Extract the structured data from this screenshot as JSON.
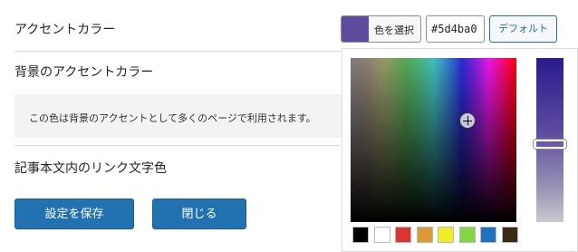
{
  "settings": {
    "accent_color_label": "アクセントカラー",
    "bg_accent_label": "背景のアクセントカラー",
    "bg_accent_description": "この色は背景のアクセントとして多くのページで利用されます。",
    "link_color_label": "記事本文内のリンク文字色",
    "save_button": "設定を保存",
    "close_button": "閉じる"
  },
  "color_picker": {
    "select_label": "色を選択",
    "hex_value": "#5d4ba0",
    "default_label": "デフォルト",
    "current_color": "#5d4ba0",
    "palette": [
      "#000000",
      "#ffffff",
      "#dd3333",
      "#dd9933",
      "#eeee22",
      "#81d742",
      "#1e73be",
      "#3a2a18"
    ]
  }
}
